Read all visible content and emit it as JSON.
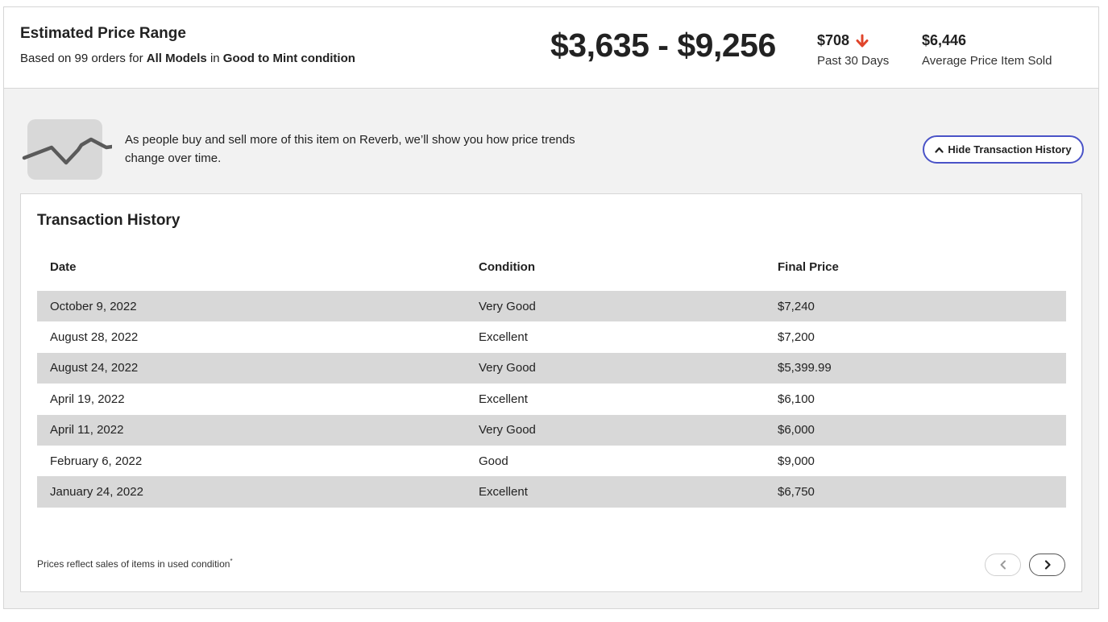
{
  "summary": {
    "title": "Estimated Price Range",
    "subtitle_prefix": "Based on 99 orders for ",
    "subtitle_models": "All Models",
    "subtitle_in": " in ",
    "subtitle_condition": "Good to Mint condition",
    "price_range": "$3,635 - $9,256",
    "change_value": "$708",
    "change_direction": "down",
    "change_label": "Past 30 Days",
    "average_value": "$6,446",
    "average_label": "Average Price Item Sold"
  },
  "trend": {
    "message": "As people buy and sell more of this item on Reverb, we’ll show you how price trends change over time.",
    "icon": "trend-chart-icon"
  },
  "hide_button": {
    "label": "Hide Transaction History",
    "icon": "chevron-up-icon"
  },
  "history": {
    "title": "Transaction History",
    "columns": [
      "Date",
      "Condition",
      "Final Price"
    ],
    "rows": [
      {
        "date": "October 9, 2022",
        "condition": "Very Good",
        "price": "$7,240"
      },
      {
        "date": "August 28, 2022",
        "condition": "Excellent",
        "price": "$7,200"
      },
      {
        "date": "August 24, 2022",
        "condition": "Very Good",
        "price": "$5,399.99"
      },
      {
        "date": "April 19, 2022",
        "condition": "Excellent",
        "price": "$6,100"
      },
      {
        "date": "April 11, 2022",
        "condition": "Very Good",
        "price": "$6,000"
      },
      {
        "date": "February 6, 2022",
        "condition": "Good",
        "price": "$9,000"
      },
      {
        "date": "January 24, 2022",
        "condition": "Excellent",
        "price": "$6,750"
      }
    ],
    "footnote": "Prices reflect sales of items in used condition",
    "footnote_mark": "*"
  },
  "pager": {
    "prev_icon": "chevron-left-icon",
    "next_icon": "chevron-right-icon"
  },
  "colors": {
    "accent_button_border": "#4a53c7",
    "down_arrow": "#e0452b",
    "row_shade": "#d8d8d8",
    "panel_bg": "#f2f2f2"
  }
}
